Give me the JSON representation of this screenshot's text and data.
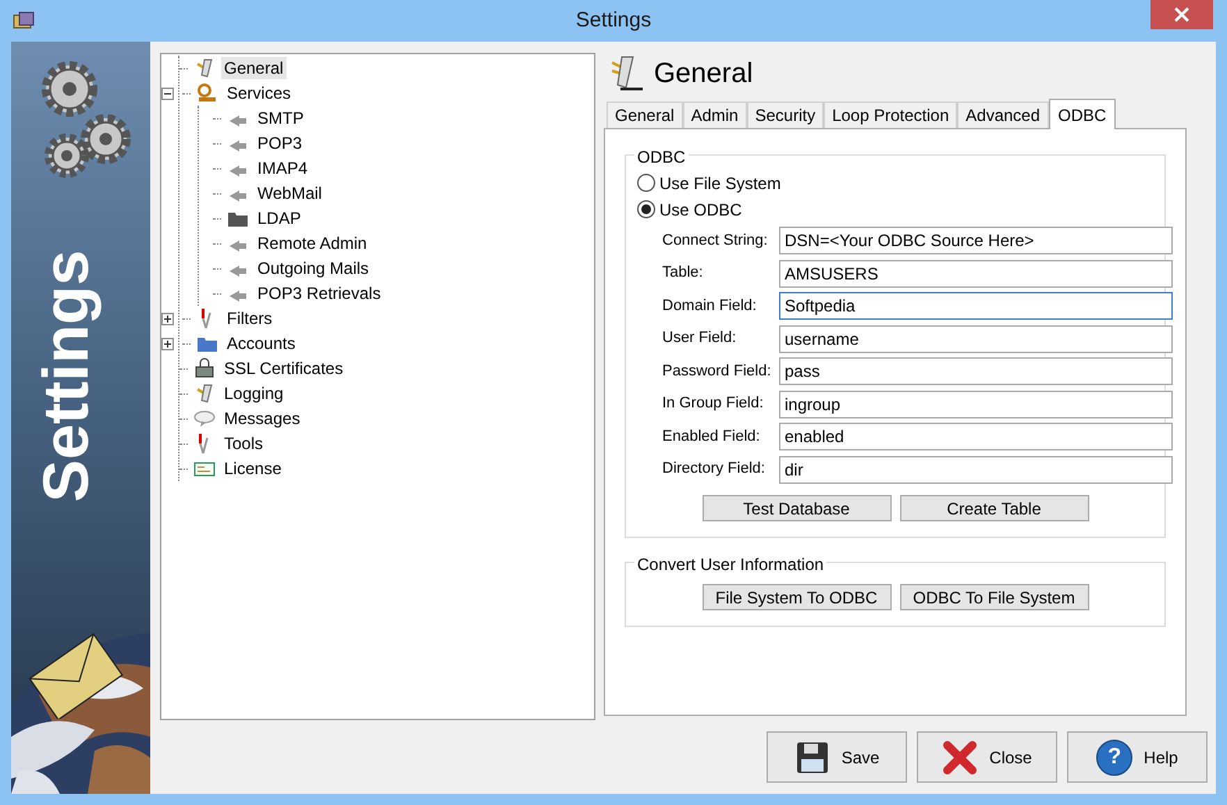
{
  "window": {
    "title": "Settings"
  },
  "banner": {
    "title": "Settings"
  },
  "tree": [
    {
      "label": "General",
      "selected": true
    },
    {
      "label": "Services",
      "selected": false,
      "expanded": true,
      "children": [
        {
          "label": "SMTP",
          "selected": false
        },
        {
          "label": "POP3",
          "selected": false
        },
        {
          "label": "IMAP4",
          "selected": false
        },
        {
          "label": "WebMail",
          "selected": false
        },
        {
          "label": "LDAP",
          "selected": false
        },
        {
          "label": "Remote Admin",
          "selected": false
        },
        {
          "label": "Outgoing Mails",
          "selected": false
        },
        {
          "label": "POP3 Retrievals",
          "selected": false
        }
      ]
    },
    {
      "label": "Filters",
      "selected": false,
      "expanded": false
    },
    {
      "label": "Accounts",
      "selected": false,
      "expanded": false
    },
    {
      "label": "SSL Certificates",
      "selected": false
    },
    {
      "label": "Logging",
      "selected": false
    },
    {
      "label": "Messages",
      "selected": false
    },
    {
      "label": "Tools",
      "selected": false
    },
    {
      "label": "License",
      "selected": false
    }
  ],
  "page_title": "General",
  "tabs": [
    {
      "label": "General",
      "selected": false
    },
    {
      "label": "Admin",
      "selected": false
    },
    {
      "label": "Security",
      "selected": false
    },
    {
      "label": "Loop Protection",
      "selected": false
    },
    {
      "label": "Advanced",
      "selected": false
    },
    {
      "label": "ODBC",
      "selected": true
    }
  ],
  "odbc_group": {
    "title": "ODBC",
    "options": [
      {
        "label": "Use File System",
        "selected": false
      },
      {
        "label": "Use ODBC",
        "selected": true
      }
    ],
    "fields": [
      {
        "label": "Connect String:",
        "value": "DSN=<Your ODBC Source Here>",
        "focused": false
      },
      {
        "label": "Table:",
        "value": "AMSUSERS",
        "focused": false
      },
      {
        "label": "Domain Field:",
        "value": "Softpedia",
        "focused": true
      },
      {
        "label": "User Field:",
        "value": "username",
        "focused": false
      },
      {
        "label": "Password Field:",
        "value": "pass",
        "focused": false
      },
      {
        "label": "In Group Field:",
        "value": "ingroup",
        "focused": false
      },
      {
        "label": "Enabled Field:",
        "value": "enabled",
        "focused": false
      },
      {
        "label": "Directory Field:",
        "value": "dir",
        "focused": false
      }
    ],
    "buttons": [
      "Test Database",
      "Create Table"
    ]
  },
  "convert_group": {
    "title": "Convert User Information",
    "buttons": [
      "File System To ODBC",
      "ODBC To File System"
    ]
  },
  "footer_buttons": [
    {
      "label": "Save",
      "kind": "save"
    },
    {
      "label": "Close",
      "kind": "close"
    },
    {
      "label": "Help",
      "kind": "help",
      "icon_glyph": "?"
    }
  ]
}
